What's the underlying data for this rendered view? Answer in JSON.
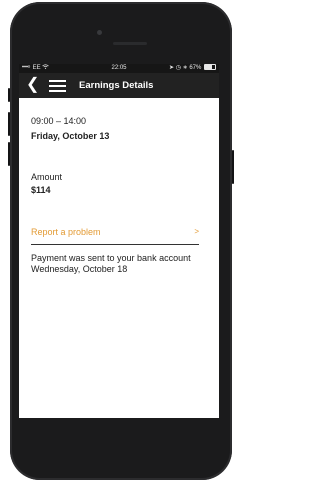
{
  "status_bar": {
    "carrier": "EE",
    "time": "22:05",
    "battery_percent": "67%",
    "battery_level": 0.67
  },
  "nav": {
    "title": "Earnings Details"
  },
  "shift": {
    "time_range": "09:00 – 14:00",
    "date": "Friday, October 13"
  },
  "amount": {
    "label": "Amount",
    "value": "$114"
  },
  "report": {
    "label": "Report a problem",
    "chevron": ">"
  },
  "payment": {
    "message": "Payment was sent to your bank account",
    "date": "Wednesday, October 18"
  },
  "colors": {
    "accent": "#e39b35",
    "nav_background": "#222222",
    "status_background": "#161616"
  },
  "icons": [
    "signal-icon",
    "wifi-icon",
    "location-icon",
    "alarm-icon",
    "bluetooth-icon",
    "battery-icon",
    "back-arrow-icon",
    "hamburger-menu-icon"
  ]
}
